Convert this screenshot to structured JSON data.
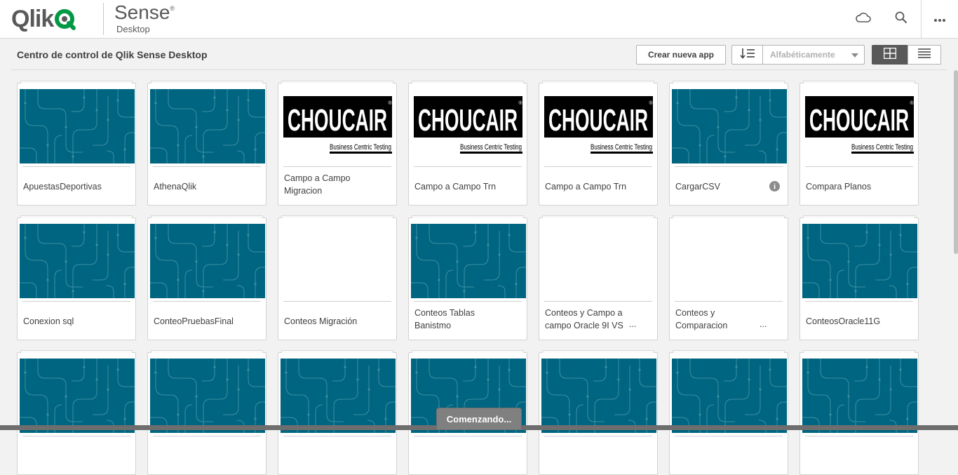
{
  "brand": {
    "qlik": "Qlik",
    "sense": "Sense",
    "reg": "®",
    "desktop": "Desktop",
    "accent": "#009845"
  },
  "topbar": {
    "icons": [
      "cloud-icon",
      "search-icon",
      "more-icon"
    ]
  },
  "hub": {
    "title": "Centro de control de Qlik Sense Desktop",
    "create_label": "Crear nueva app",
    "sort_value": "Alfabéticamente",
    "view_modes": [
      "grid",
      "list"
    ],
    "active_view": "grid"
  },
  "apps": [
    {
      "name": "ApuestasDeportivas",
      "thumb": "pattern"
    },
    {
      "name": "AthenaQlik",
      "thumb": "pattern"
    },
    {
      "name": "Campo a Campo Migracion",
      "thumb": "choucair"
    },
    {
      "name": "Campo a Campo Trn",
      "thumb": "choucair"
    },
    {
      "name": "Campo a Campo Trn",
      "thumb": "choucair"
    },
    {
      "name": "CargarCSV",
      "thumb": "pattern",
      "info": "i"
    },
    {
      "name": "Compara Planos",
      "thumb": "choucair"
    },
    {
      "name": "Conexion sql",
      "thumb": "pattern"
    },
    {
      "name": "ConteoPruebasFinal",
      "thumb": "pattern"
    },
    {
      "name": "Conteos Migración",
      "thumb": "blank"
    },
    {
      "name": "Conteos Tablas Banistmo",
      "thumb": "pattern"
    },
    {
      "name": "Conteos y Campo a campo Oracle 9I VS",
      "thumb": "blank",
      "ellipsis": "..."
    },
    {
      "name": "Conteos y Comparacion",
      "thumb": "blank",
      "ellipsis": "..."
    },
    {
      "name": "ConteosOracle11G",
      "thumb": "pattern"
    },
    {
      "name": "",
      "thumb": "pattern"
    },
    {
      "name": "",
      "thumb": "pattern"
    },
    {
      "name": "",
      "thumb": "pattern"
    },
    {
      "name": "",
      "thumb": "pattern"
    },
    {
      "name": "",
      "thumb": "pattern"
    },
    {
      "name": "",
      "thumb": "pattern"
    },
    {
      "name": "",
      "thumb": "pattern"
    }
  ],
  "choucair": {
    "wordmark": "CHOUCAIR",
    "reg": "®",
    "tagline": "Business Centric Testing"
  },
  "toast": {
    "label": "Comenzando..."
  },
  "colors": {
    "thumb_bg": "#006580",
    "thumb_line": "#3d8fa3",
    "toast_bg": "#808080"
  }
}
